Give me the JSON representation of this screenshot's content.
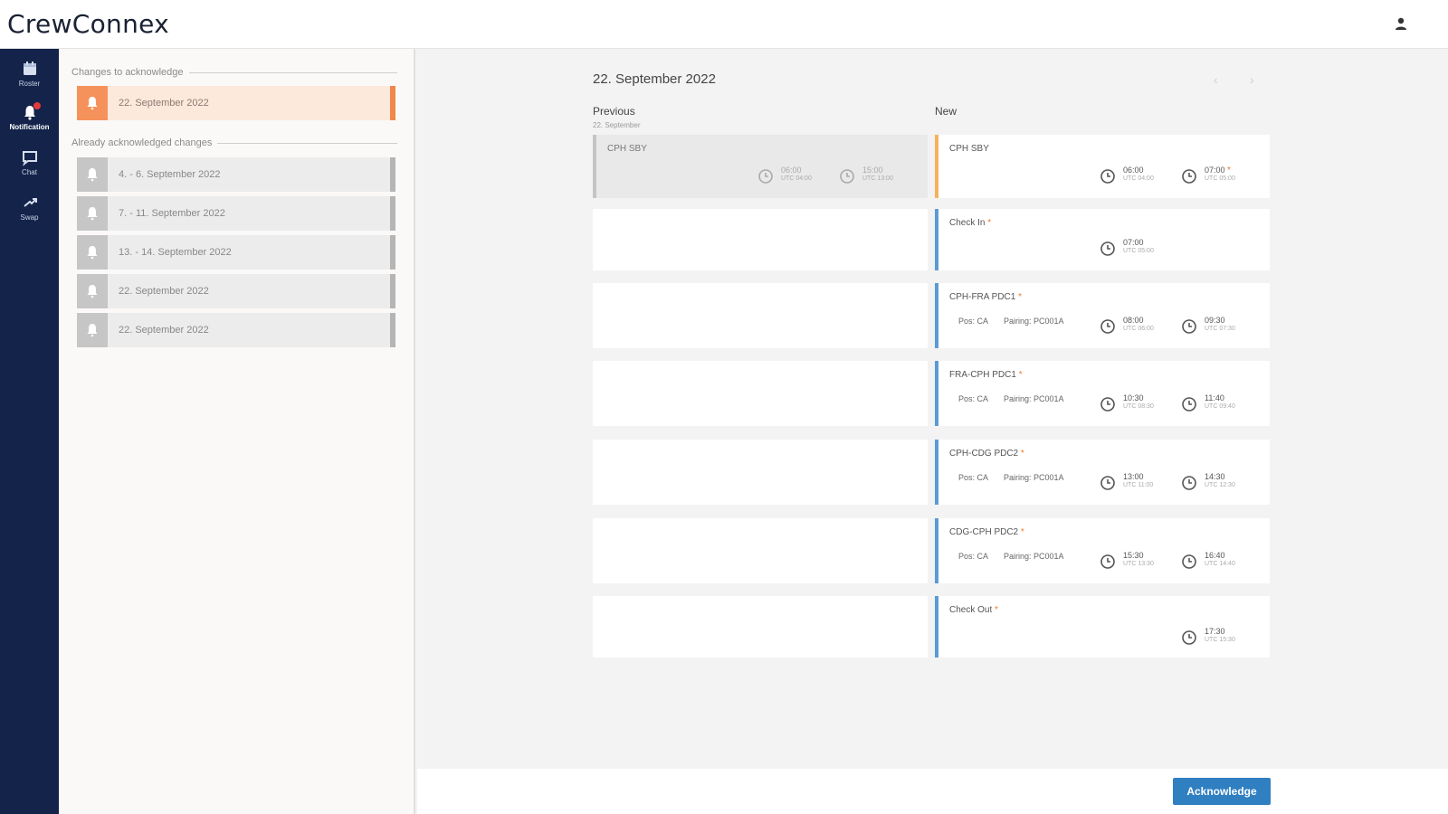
{
  "app": {
    "title": "CrewConnex"
  },
  "nav": {
    "items": [
      {
        "label": "Roster",
        "icon": "calendar-icon"
      },
      {
        "label": "Notification",
        "icon": "bell-icon",
        "active": true,
        "badge": true
      },
      {
        "label": "Chat",
        "icon": "chat-icon"
      },
      {
        "label": "Swap",
        "icon": "swap-icon"
      }
    ]
  },
  "changes": {
    "pending_title": "Changes to acknowledge",
    "pending": [
      {
        "label": "22. September 2022"
      }
    ],
    "done_title": "Already acknowledged changes",
    "done": [
      {
        "label": "4. - 6. September 2022"
      },
      {
        "label": "7. - 11. September 2022"
      },
      {
        "label": "13. - 14. September 2022"
      },
      {
        "label": "22. September 2022"
      },
      {
        "label": "22. September 2022"
      }
    ]
  },
  "detail": {
    "date": "22. September 2022",
    "prev_arrow": "‹",
    "next_arrow": "›",
    "previous_label": "Previous",
    "previous_sub": "22. September",
    "new_label": "New",
    "previous_cards": [
      {
        "title": "CPH SBY",
        "start": "06:00",
        "start_utc": "UTC 04:00",
        "end": "15:00",
        "end_utc": "UTC 13:00"
      }
    ],
    "new_cards": [
      {
        "title": "CPH SBY",
        "changed": false,
        "start": "06:00",
        "start_utc": "UTC 04:00",
        "end": "07:00",
        "end_utc": "UTC 05:00",
        "end_changed": true,
        "accent": "#f5b25b"
      },
      {
        "title": "Check In",
        "changed": true,
        "start": "07:00",
        "start_utc": "UTC 05:00",
        "accent": "#5b9bd5"
      },
      {
        "title": "CPH-FRA PDC1",
        "changed": true,
        "pos": "Pos: CA",
        "pairing": "Pairing: PC001A",
        "start": "08:00",
        "start_utc": "UTC 06:00",
        "end": "09:30",
        "end_utc": "UTC 07:30",
        "accent": "#5b9bd5"
      },
      {
        "title": "FRA-CPH PDC1",
        "changed": true,
        "pos": "Pos: CA",
        "pairing": "Pairing: PC001A",
        "start": "10:30",
        "start_utc": "UTC 08:30",
        "end": "11:40",
        "end_utc": "UTC 09:40",
        "accent": "#5b9bd5"
      },
      {
        "title": "CPH-CDG PDC2",
        "changed": true,
        "pos": "Pos: CA",
        "pairing": "Pairing: PC001A",
        "start": "13:00",
        "start_utc": "UTC 11:00",
        "end": "14:30",
        "end_utc": "UTC 12:30",
        "accent": "#5b9bd5"
      },
      {
        "title": "CDG-CPH PDC2",
        "changed": true,
        "pos": "Pos: CA",
        "pairing": "Pairing: PC001A",
        "start": "15:30",
        "start_utc": "UTC 13:30",
        "end": "16:40",
        "end_utc": "UTC 14:40",
        "accent": "#5b9bd5"
      },
      {
        "title": "Check Out",
        "changed": true,
        "end": "17:30",
        "end_utc": "UTC 15:30",
        "accent": "#5b9bd5"
      }
    ],
    "star": "*",
    "acknowledge_label": "Acknowledge"
  }
}
